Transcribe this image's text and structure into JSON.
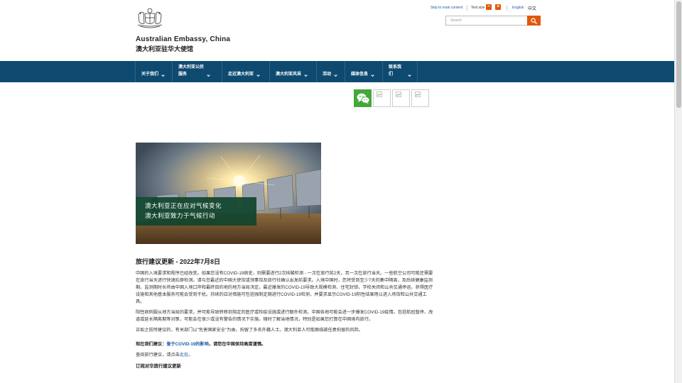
{
  "header": {
    "brand_en": "Australian Embassy, China",
    "brand_zh": "澳大利亚驻华大使馆"
  },
  "utility": {
    "skip_link": "Skip to main content",
    "text_size_label": "Text size",
    "decrease_label": "−",
    "increase_label": "+",
    "lang_en": "English",
    "lang_zh": "中文"
  },
  "search": {
    "placeholder": "Search",
    "icon": "search-icon"
  },
  "nav": {
    "items": [
      {
        "line1": "关于我们",
        "line2": ""
      },
      {
        "line1": "澳大利亚公民",
        "line2": "服务"
      },
      {
        "line1": "走近澳大利亚",
        "line2": ""
      },
      {
        "line1": "澳大利亚风采",
        "line2": ""
      },
      {
        "line1": "活动",
        "line2": ""
      },
      {
        "line1": "媒体信息",
        "line2": ""
      },
      {
        "line1": "联系我们",
        "line2": ""
      }
    ]
  },
  "social": {
    "icons": [
      "wechat-icon",
      "broken-image-icon",
      "broken-image-icon",
      "broken-image-icon"
    ]
  },
  "hero": {
    "line1": "澳大利亚正在应对气候变化",
    "line2": "澳大利亚致力于气候行动"
  },
  "article": {
    "title": "旅行建议更新 - 2022年7月8日",
    "para1": "中国的入境要求和程序已经改变。如果您没有COVID-19病史，则需要进行2次核酸检测 - 一次在旅行前2天，另一次在旅行当天。一些航空公司可能还需要在旅行当天进行快速抗原检测。请与您最近的中国大使馆或领事馆及旅行社确认出发前要求。入境中国时，您将受到至少7天的集中隔离，及后续健康监测期。监测期时长将由中国入境口岸和最终目的地的地方当局决定。最近爆发的COVID-19导致大规模检测、住宅封锁，学校关闭和公共交通停运。获得医疗设施和其他基本服务可能会受到干扰。持续的应对措施可包括强制定期进行COVID-19检测，并要求显示COVID-19阴性结果用以进入场馆和公共交通工具。",
    "para2": "阳性病例服从地方当局的要求，并可能导致转移到指定的医疗或检疫设施或进行额外检测。中国各地可能会进一步爆发COVID-19疫情。包括航班暂停、改道或延长隔离期等对策，可能会在很少或没有警告的情况下实施。随时了解当地情况，特别是如果您打算在中国境内旅行。",
    "para3": "正如之前所建议的，有关部门以\"危害国家安全\"为由，拘留了多名外籍人士。澳大利亚人可能面临被任意拘留的风险。",
    "advice_prefix": "现在我们建议：",
    "advice_link": "鉴于COVID-19的影响",
    "advice_suffix": "，请您在中国保持高度谨慎。",
    "see_prefix": "查阅旅行建议，请点击",
    "see_link": "此处",
    "see_suffix": "。",
    "subscribe_heading": "订阅对华旅行建议更新"
  },
  "colors": {
    "nav_bg": "#0e4a70",
    "accent": "#e0570c",
    "link": "#1a5fa5",
    "caption_bg": "#10442c",
    "wechat_green": "#44a83a"
  }
}
